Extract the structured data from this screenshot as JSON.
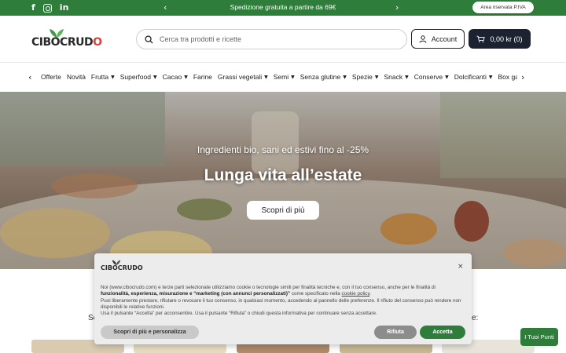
{
  "topbar": {
    "promo_text": "Spedizione gratuita a partire da 69€",
    "reserved_area": "Area riservata P.IVA",
    "social": [
      "facebook-icon",
      "instagram-icon",
      "linkedin-icon"
    ],
    "bg_color": "#2f7d3a"
  },
  "header": {
    "logo_text": "CIBOCRUDO",
    "search_placeholder": "Cerca tra prodotti e ricette",
    "account_label": "Account",
    "cart_label": "0,00 kr (0)"
  },
  "categories": [
    {
      "label": "Offerte",
      "dropdown": false
    },
    {
      "label": "Novità",
      "dropdown": false
    },
    {
      "label": "Frutta",
      "dropdown": true
    },
    {
      "label": "Superfood",
      "dropdown": true
    },
    {
      "label": "Cacao",
      "dropdown": true
    },
    {
      "label": "Farine",
      "dropdown": false
    },
    {
      "label": "Grassi vegetali",
      "dropdown": true
    },
    {
      "label": "Semi",
      "dropdown": true
    },
    {
      "label": "Senza glutine",
      "dropdown": true
    },
    {
      "label": "Spezie",
      "dropdown": true
    },
    {
      "label": "Snack",
      "dropdown": true
    },
    {
      "label": "Conserve",
      "dropdown": true
    },
    {
      "label": "Dolcificanti",
      "dropdown": true
    },
    {
      "label": "Box gastronomi",
      "dropdown": false
    }
  ],
  "hero": {
    "subtitle": "Ingredienti bio, sani ed estivi fino al -25%",
    "title": "Lunga vita all’estate",
    "cta_label": "Scopri di più"
  },
  "below": {
    "fragment_left": "Sc",
    "fragment_right": "e:"
  },
  "cookie": {
    "logo_text": "CIBOCRUDO",
    "line1": "Noi (www.cibocrudo.com) e terze parti selezionate utilizziamo cookie o tecnologie simili per finalità tecniche e, con il tuo consenso, anche per le finalità di",
    "line2_bold": "funzionalità, esperienza, misurazione e “marketing (con annunci personalizzati)”",
    "line2_rest": " come specificato nella ",
    "policy_link": "cookie policy",
    "line2_end": ".",
    "line3": "Puoi liberamente prestare, rifiutare o revocare il tuo consenso, in qualsiasi momento, accedendo al pannello delle preferenze. Il rifiuto del consenso può rendere non disponibili le relative funzioni.",
    "line4": "Usa il pulsante “Accetta” per acconsentire. Usa il pulsante “Rifiuta” o chiudi questa informativa per continuare senza accettare.",
    "more_label": "Scopri di più e personalizza",
    "reject_label": "Rifiuta",
    "accept_label": "Accetta",
    "close_glyph": "×"
  },
  "points_button": "I Tuoi Punti",
  "colors": {
    "brand_green": "#2f7d3a",
    "cart_dark": "#1d2230",
    "logo_red": "#d9433a"
  }
}
